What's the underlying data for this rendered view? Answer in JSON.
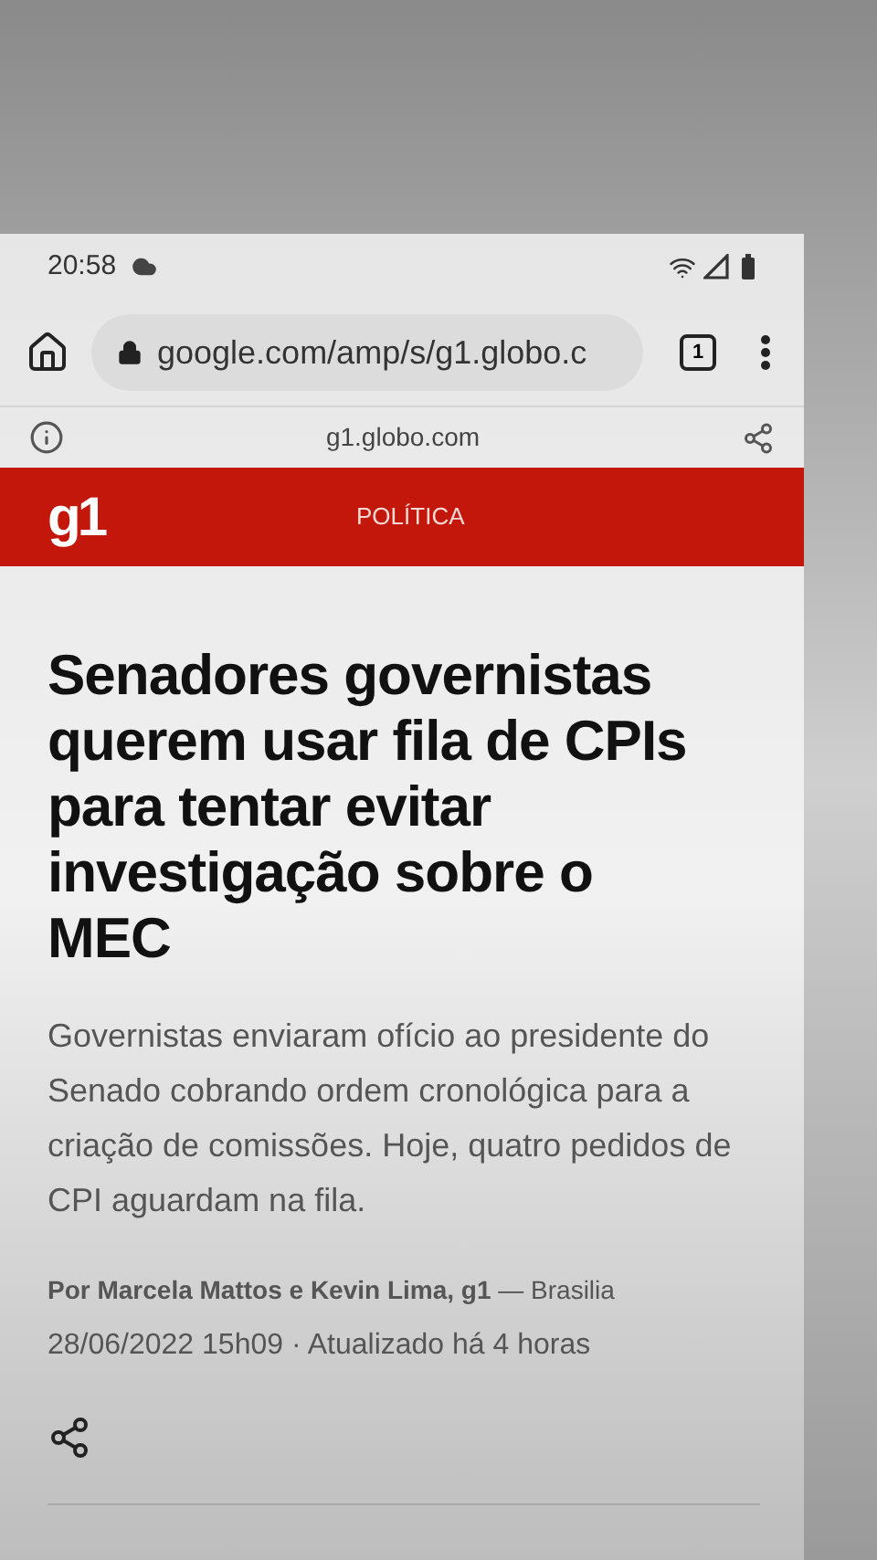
{
  "status_bar": {
    "time": "20:58"
  },
  "browser": {
    "url": "google.com/amp/s/g1.globo.c",
    "tab_count": "1"
  },
  "site_bar": {
    "domain": "g1.globo.com"
  },
  "header": {
    "logo": "g1",
    "section": "POLÍTICA"
  },
  "article": {
    "headline": "Senadores governistas querem usar fila de CPIs para tentar evitar investigação sobre o MEC",
    "summary": "Governistas enviaram ofício ao presidente do Senado cobrando ordem cronológica para a criação de comissões. Hoje, quatro pedidos de CPI aguardam na fila.",
    "byline": "**Por Marcela Mattos e Kevin Lima, g1** — Brasilia",
    "date": "28/06/2022 15h09 · Atualizado há 4 horas"
  }
}
